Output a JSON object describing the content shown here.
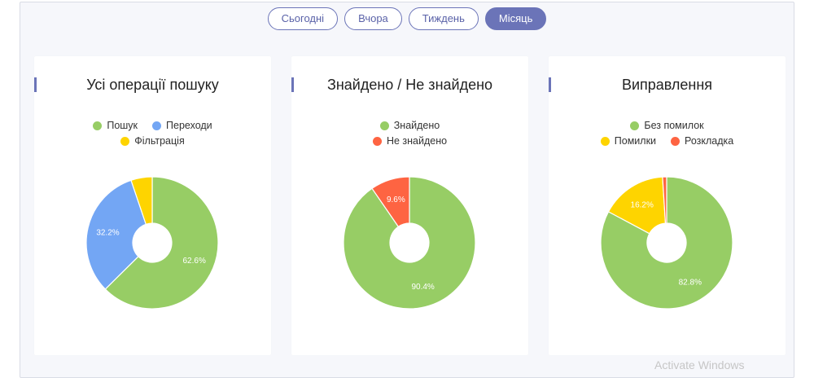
{
  "tabs": [
    {
      "label": "Сьогодні",
      "active": false
    },
    {
      "label": "Вчора",
      "active": false
    },
    {
      "label": "Тиждень",
      "active": false
    },
    {
      "label": "Місяць",
      "active": true
    }
  ],
  "watermark": "Activate Windows",
  "chart_data": [
    {
      "type": "pie",
      "title": "Усі операції пошуку",
      "legend_layout": [
        [
          "Пошук",
          "Переходи"
        ],
        [
          "Фільтрація"
        ]
      ],
      "series": [
        {
          "name": "Пошук",
          "value": 62.6,
          "label": "62.6%",
          "color": "#97cd65"
        },
        {
          "name": "Переходи",
          "value": 32.2,
          "label": "32.2%",
          "color": "#73a6f4"
        },
        {
          "name": "Фільтрація",
          "value": 5.2,
          "label": "",
          "color": "#fed400"
        }
      ]
    },
    {
      "type": "pie",
      "title": "Знайдено / Не знайдено",
      "legend_layout": [
        [
          "Знайдено"
        ],
        [
          "Не знайдено"
        ]
      ],
      "series": [
        {
          "name": "Знайдено",
          "value": 90.4,
          "label": "90.4%",
          "color": "#97cd65"
        },
        {
          "name": "Не знайдено",
          "value": 9.6,
          "label": "9.6%",
          "color": "#fe6442"
        }
      ]
    },
    {
      "type": "pie",
      "title": "Виправлення",
      "legend_layout": [
        [
          "Без помилок"
        ],
        [
          "Помилки",
          "Розкладка"
        ]
      ],
      "series": [
        {
          "name": "Без помилок",
          "value": 82.8,
          "label": "82.8%",
          "color": "#97cd65"
        },
        {
          "name": "Помилки",
          "value": 16.2,
          "label": "16.2%",
          "color": "#fed400"
        },
        {
          "name": "Розкладка",
          "value": 1.0,
          "label": "",
          "color": "#fe6442"
        }
      ]
    }
  ]
}
